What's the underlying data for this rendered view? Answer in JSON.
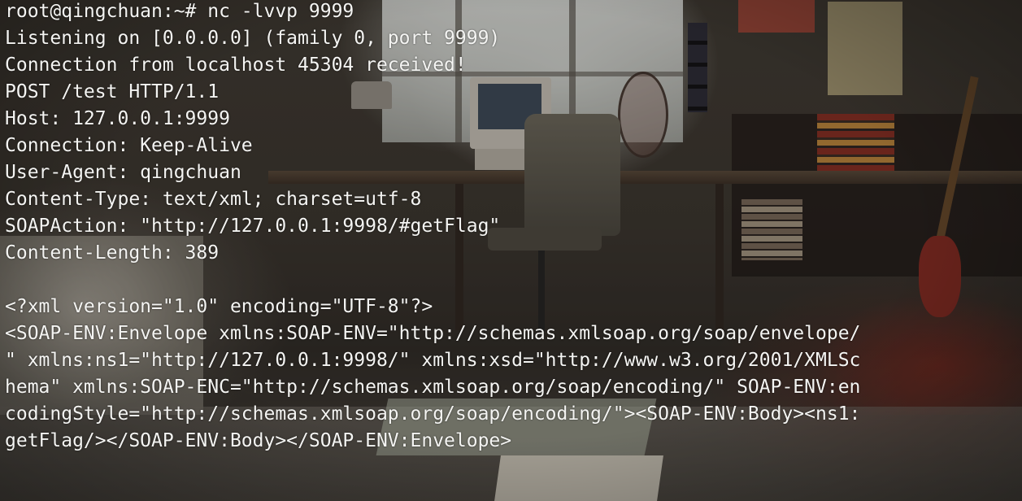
{
  "terminal": {
    "lines": [
      "root@qingchuan:~# nc -lvvp 9999",
      "Listening on [0.0.0.0] (family 0, port 9999)",
      "Connection from localhost 45304 received!",
      "POST /test HTTP/1.1",
      "Host: 127.0.0.1:9999",
      "Connection: Keep-Alive",
      "User-Agent: qingchuan",
      "Content-Type: text/xml; charset=utf-8",
      "SOAPAction: \"http://127.0.0.1:9998/#getFlag\"",
      "Content-Length: 389",
      "",
      "<?xml version=\"1.0\" encoding=\"UTF-8\"?>",
      "<SOAP-ENV:Envelope xmlns:SOAP-ENV=\"http://schemas.xmlsoap.org/soap/envelope/",
      "\" xmlns:ns1=\"http://127.0.0.1:9998/\" xmlns:xsd=\"http://www.w3.org/2001/XMLSc",
      "hema\" xmlns:SOAP-ENC=\"http://schemas.xmlsoap.org/soap/encoding/\" SOAP-ENV:en",
      "codingStyle=\"http://schemas.xmlsoap.org/soap/encoding/\"><SOAP-ENV:Body><ns1:",
      "getFlag/></SOAP-ENV:Body></SOAP-ENV:Envelope>"
    ]
  }
}
